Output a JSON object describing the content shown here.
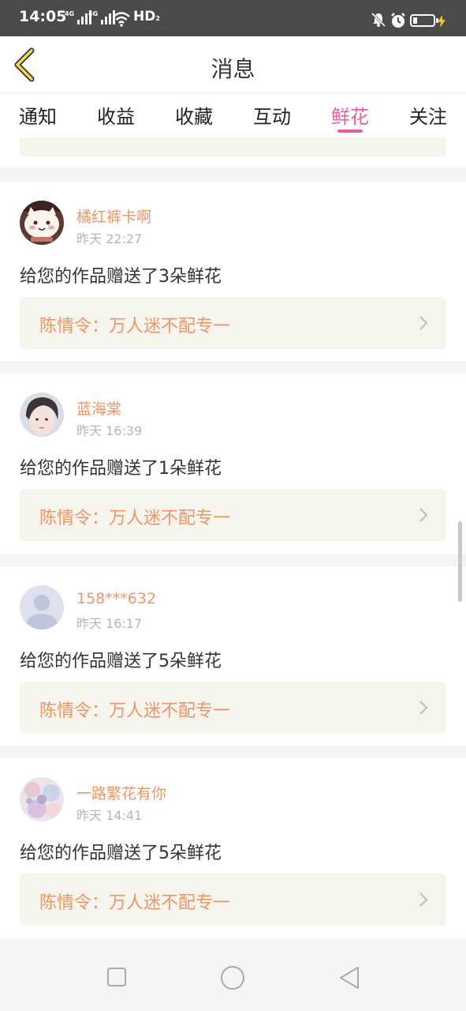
{
  "status_bar": {
    "time": "14:05",
    "network1": "4G",
    "network2": "4G",
    "hd_label": "HD",
    "hd_sub": "2"
  },
  "header": {
    "title": "消息",
    "back_icon": "chevron-left-icon"
  },
  "tabs": [
    {
      "label": "通知",
      "active": false
    },
    {
      "label": "收益",
      "active": false
    },
    {
      "label": "收藏",
      "active": false
    },
    {
      "label": "互动",
      "active": false
    },
    {
      "label": "鲜花",
      "active": true
    },
    {
      "label": "关注",
      "active": false
    }
  ],
  "messages": [
    {
      "username": "橘红裤卡啊",
      "time": "昨天 22:27",
      "text": "给您的作品赠送了3朵鲜花",
      "work_title": "陈情令：万人迷不配专一",
      "avatar": "cartoon-cat-avatar"
    },
    {
      "username": "蓝海棠",
      "time": "昨天 16:39",
      "text": "给您的作品赠送了1朵鲜花",
      "work_title": "陈情令：万人迷不配专一",
      "avatar": "portrait-avatar"
    },
    {
      "username": "158***632",
      "time": "昨天 16:17",
      "text": "给您的作品赠送了5朵鲜花",
      "work_title": "陈情令：万人迷不配专一",
      "avatar": "default-user-avatar"
    },
    {
      "username": "一路繁花有你",
      "time": "昨天 14:41",
      "text": "给您的作品赠送了5朵鲜花",
      "work_title": "陈情令：万人迷不配专一",
      "avatar": "floral-avatar"
    }
  ],
  "navigation_bar": {
    "buttons": [
      "recents-square-icon",
      "home-circle-icon",
      "back-triangle-icon"
    ]
  },
  "colors": {
    "accent_pink": "#e85fa0",
    "username_orange": "#ee9566",
    "link_box_bg": "#f5f4ed",
    "status_bar_bg": "#4a4a4a"
  }
}
